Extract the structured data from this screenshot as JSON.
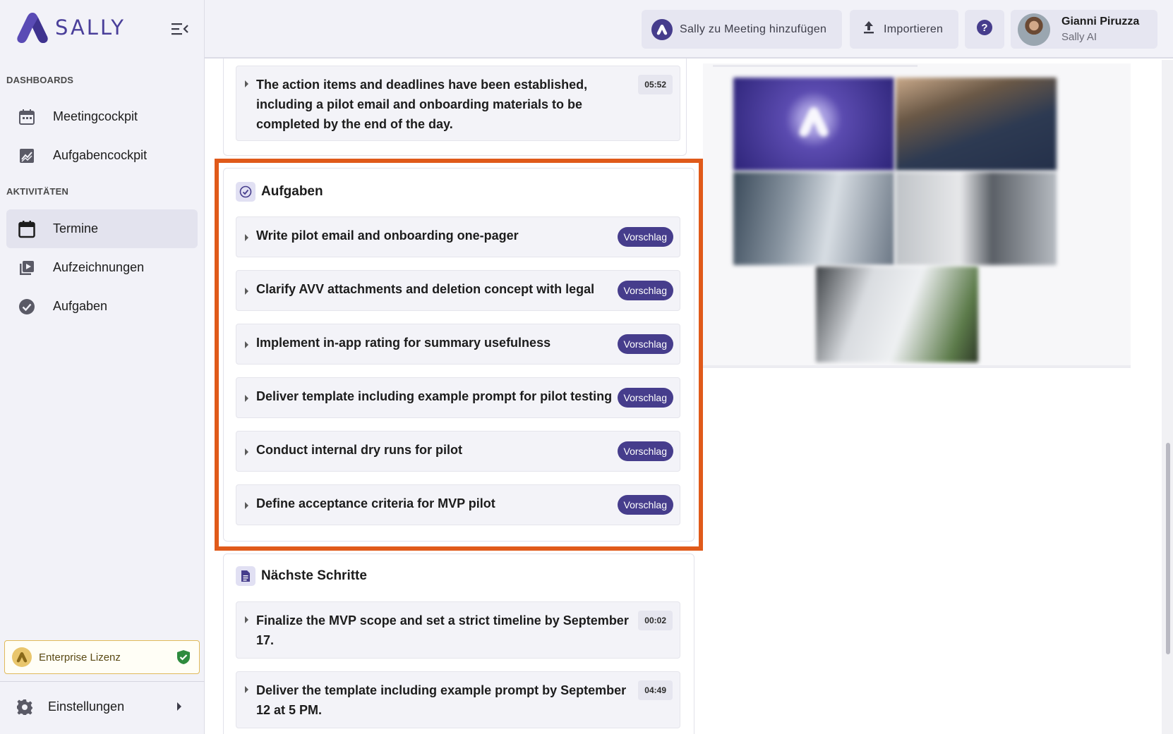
{
  "app": {
    "logo_text": "SALLY"
  },
  "sidebar": {
    "section_dashboards": "DASHBOARDS",
    "section_activities": "AKTIVITÄTEN",
    "items": [
      {
        "label": "Meetingcockpit",
        "icon": "calendar-grid-icon"
      },
      {
        "label": "Aufgabencockpit",
        "icon": "chart-icon"
      },
      {
        "label": "Termine",
        "icon": "calendar-icon",
        "active": true
      },
      {
        "label": "Aufzeichnungen",
        "icon": "video-library-icon"
      },
      {
        "label": "Aufgaben",
        "icon": "check-circle-icon"
      }
    ],
    "license_label": "Enterprise Lizenz",
    "settings_label": "Einstellungen"
  },
  "topbar": {
    "add_to_meeting_label": "Sally zu Meeting hinzufügen",
    "import_label": "Importieren",
    "help_icon": "help-icon",
    "user_name": "Gianni Piruzza",
    "user_sub": "Sally AI"
  },
  "summary": {
    "top_item": {
      "text_line1": "The action items and deadlines have been established,",
      "text_line2": "including a pilot email and onboarding materials to be",
      "text_line3": "completed by the end of the day.",
      "time": "05:52"
    }
  },
  "tasks": {
    "title": "Aufgaben",
    "badge_label": "Vorschlag",
    "items": [
      "Write pilot email and onboarding one-pager",
      "Clarify AVV attachments and deletion concept with legal",
      "Implement in-app rating for summary usefulness",
      "Deliver template including example prompt for pilot testing",
      "Conduct internal dry runs for pilot",
      "Define acceptance criteria for MVP pilot"
    ]
  },
  "next_steps": {
    "title": "Nächste Schritte",
    "items": [
      {
        "line1": "Finalize the MVP scope and set a strict timeline by September",
        "line2": "17.",
        "time": "00:02"
      },
      {
        "line1": "Deliver the template including example prompt by September",
        "line2": "12 at 5 PM.",
        "time": "04:49"
      }
    ]
  },
  "colors": {
    "accent": "#463d8c",
    "highlight": "#e05a1a",
    "license_border": "#e0b95a",
    "license_check": "#2e8b3e"
  }
}
